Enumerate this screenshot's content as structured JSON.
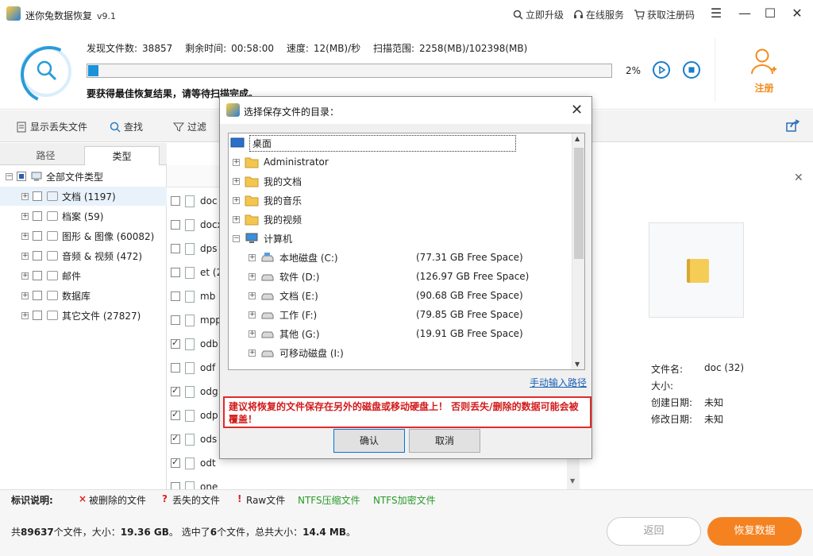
{
  "app": {
    "title": "迷你兔数据恢复",
    "version": "v9.1"
  },
  "titlebar": {
    "upgrade": "立即升级",
    "service": "在线服务",
    "get_code": "获取注册码"
  },
  "scan": {
    "found_label": "发现文件数:",
    "found_value": "38857",
    "remaining_label": "剩余时间:",
    "remaining_value": "00:58:00",
    "speed_label": "速度:",
    "speed_value": "12(MB)/秒",
    "range_label": "扫描范围:",
    "range_value": "2258(MB)/102398(MB)",
    "percent_text": "2%",
    "progress_fraction": 0.02,
    "hint": "要获得最佳恢复结果，请等待扫描完成。"
  },
  "register_label": "注册",
  "toolbar": {
    "show_lost": "显示丢失文件",
    "find": "查找",
    "filter": "过滤"
  },
  "tabs": {
    "path": "路径",
    "type": "类型"
  },
  "tree": {
    "root": "全部文件类型",
    "items": [
      {
        "label": "文档 (1197)"
      },
      {
        "label": "档案 (59)"
      },
      {
        "label": "图形 & 图像 (60082)"
      },
      {
        "label": "音频 & 视频 (472)"
      },
      {
        "label": "邮件"
      },
      {
        "label": "数据库"
      },
      {
        "label": "其它文件 (27827)"
      }
    ]
  },
  "files": [
    {
      "name": "doc",
      "checked": false
    },
    {
      "name": "docx",
      "checked": false
    },
    {
      "name": "dps",
      "checked": false
    },
    {
      "name": "et (2",
      "checked": false
    },
    {
      "name": "mb",
      "checked": false
    },
    {
      "name": "mpp",
      "checked": false
    },
    {
      "name": "odb",
      "checked": true
    },
    {
      "name": "odf",
      "checked": false
    },
    {
      "name": "odg",
      "checked": true
    },
    {
      "name": "odp",
      "checked": true
    },
    {
      "name": "ods",
      "checked": true
    },
    {
      "name": "odt",
      "checked": true
    },
    {
      "name": "one",
      "checked": false
    }
  ],
  "preview": {
    "name_label": "文件名:",
    "name_value": "doc (32)",
    "size_label": "大小:",
    "size_value": "",
    "created_label": "创建日期:",
    "created_value": "未知",
    "modified_label": "修改日期:",
    "modified_value": "未知"
  },
  "legend": {
    "title": "标识说明:",
    "deleted": "被删除的文件",
    "lost": "丢失的文件",
    "raw": "Raw文件",
    "ntfs_compressed": "NTFS压缩文件",
    "ntfs_encrypted": "NTFS加密文件",
    "deleted_mark": "×",
    "lost_mark": "?",
    "raw_mark": "!",
    "colors": {
      "red": "#e02020",
      "green": "#2a9a2a"
    }
  },
  "status": {
    "total_prefix": "共",
    "total_count": "89637",
    "total_mid": "个文件，大小：",
    "total_size": "19.36 GB",
    "sel_prefix": "。  选中了",
    "sel_count": "6",
    "sel_mid": "个文件，总共大小：",
    "sel_size": "14.4 MB",
    "sel_suffix": "。"
  },
  "buttons": {
    "back": "返回",
    "recover": "恢复数据"
  },
  "dialog": {
    "title": "选择保存文件的目录：",
    "tree": [
      {
        "label": "桌面",
        "fs": ""
      },
      {
        "label": "Administrator",
        "fs": ""
      },
      {
        "label": "我的文档",
        "fs": ""
      },
      {
        "label": "我的音乐",
        "fs": ""
      },
      {
        "label": "我的视频",
        "fs": ""
      },
      {
        "label": "计算机",
        "fs": ""
      },
      {
        "label": "本地磁盘 (C:)",
        "fs": "(77.31 GB Free Space)"
      },
      {
        "label": "软件 (D:)",
        "fs": "(126.97 GB Free Space)"
      },
      {
        "label": "文档 (E:)",
        "fs": "(90.68 GB Free Space)"
      },
      {
        "label": "工作 (F:)",
        "fs": "(79.85 GB Free Space)"
      },
      {
        "label": "其他 (G:)",
        "fs": "(19.91 GB Free Space)"
      },
      {
        "label": "可移动磁盘 (I:)",
        "fs": ""
      }
    ],
    "manual_path": "手动输入路径",
    "warning": "建议将恢复的文件保存在另外的磁盘或移动硬盘上！ 否则丢失/删除的数据可能会被覆盖！",
    "ok": "确认",
    "cancel": "取消"
  }
}
